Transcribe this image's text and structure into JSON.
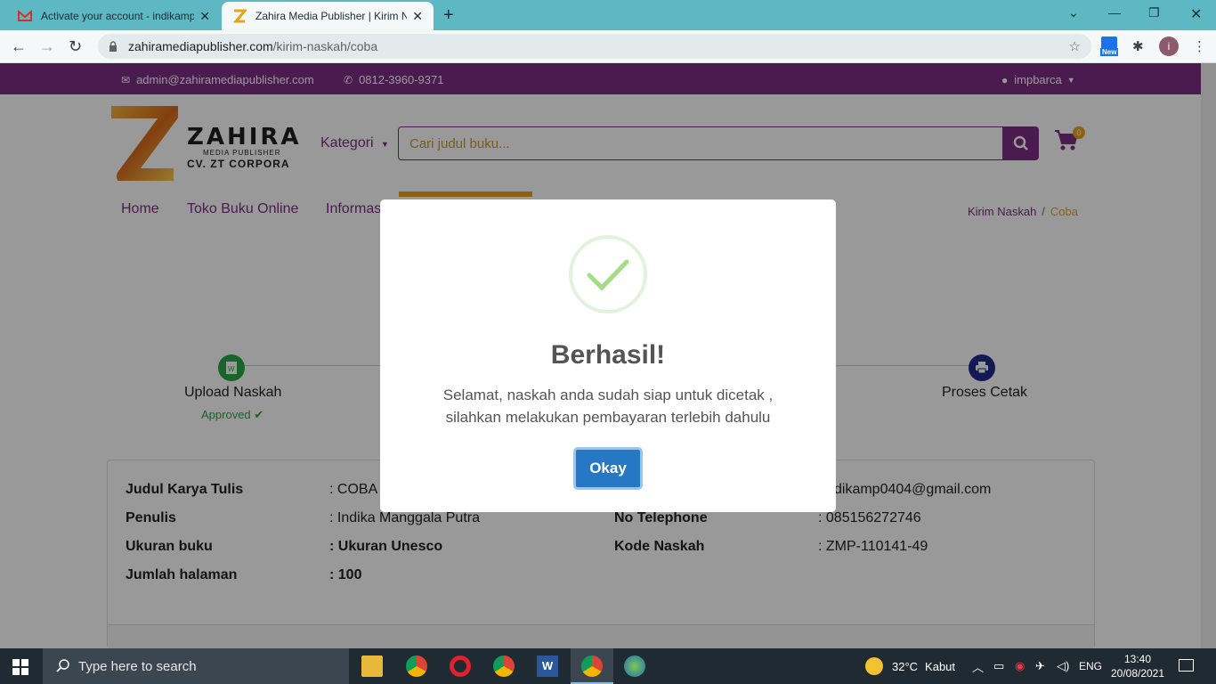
{
  "browser": {
    "tabs": [
      {
        "title": "Activate your account - indikamp",
        "active": false
      },
      {
        "title": "Zahira Media Publisher | Kirim Na",
        "active": true
      }
    ],
    "url_domain": "zahiramediapublisher.com",
    "url_path": "/kirim-naskah/coba",
    "ext_badge": "New",
    "profile_initial": "i"
  },
  "site": {
    "email": "admin@zahiramediapublisher.com",
    "phone": "0812-3960-9371",
    "user": "impbarca",
    "logo_name": "ZAHIRA",
    "logo_sub1": "MEDIA PUBLISHER",
    "logo_sub2": "CV. ZT CORPORA",
    "kategori_label": "Kategori",
    "search_placeholder": "Cari judul buku...",
    "cart_count": "0",
    "menu": [
      "Home",
      "Toko Buku Online",
      "Informas"
    ],
    "breadcrumb": {
      "parent": "Kirim Naskah",
      "current": "Coba"
    }
  },
  "steps": [
    {
      "label": "Upload Naskah",
      "status": "Approved ✔"
    },
    {
      "label": "Proses Cetak",
      "status": ""
    }
  ],
  "info": {
    "left": [
      {
        "key": "Judul Karya Tulis",
        "value": ": COBA"
      },
      {
        "key": "Penulis",
        "value": ": Indika Manggala Putra"
      },
      {
        "key": "Ukuran buku",
        "value": ": Ukuran Unesco"
      },
      {
        "key": "Jumlah halaman",
        "value": ": 100"
      }
    ],
    "right": [
      {
        "key": "",
        "value": "dikamp0404@gmail.com"
      },
      {
        "key": "No Telephone",
        "value": ": 085156272746"
      },
      {
        "key": "Kode Naskah",
        "value": ": ZMP-110141-49"
      }
    ]
  },
  "modal": {
    "title": "Berhasil!",
    "line1": "Selamat, naskah anda sudah siap untuk dicetak ,",
    "line2": "silahkan melakukan pembayaran terlebih dahulu",
    "button": "Okay"
  },
  "taskbar": {
    "search_placeholder": "Type here to search",
    "weather_temp": "32°C",
    "weather_desc": "Kabut",
    "lang": "ENG",
    "time": "13:40",
    "date": "20/08/2021"
  },
  "colors": {
    "brand": "#7b2d82",
    "accent": "#e8a317",
    "success": "#28a745",
    "button": "#2778c4"
  }
}
